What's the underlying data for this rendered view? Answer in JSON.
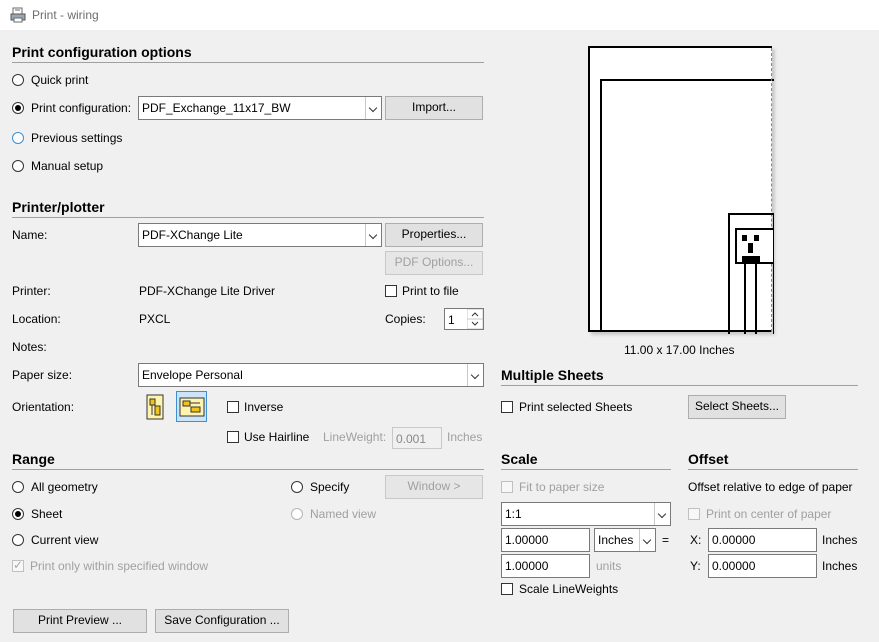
{
  "window": {
    "title": "Print - wiring"
  },
  "config": {
    "heading": "Print configuration options",
    "quick_print": "Quick print",
    "print_configuration": "Print configuration:",
    "config_value": "PDF_Exchange_11x17_BW",
    "import_button": "Import...",
    "previous_settings": "Previous settings",
    "manual_setup": "Manual setup"
  },
  "printer": {
    "heading": "Printer/plotter",
    "name_label": "Name:",
    "name_value": "PDF-XChange Lite",
    "properties_button": "Properties...",
    "pdf_options_button": "PDF Options...",
    "printer_label": "Printer:",
    "printer_value": "PDF-XChange Lite Driver",
    "print_to_file": "Print to file",
    "location_label": "Location:",
    "location_value": "PXCL",
    "copies_label": "Copies:",
    "copies_value": "1",
    "notes_label": "Notes:",
    "paper_size_label": "Paper size:",
    "paper_size_value": "Envelope Personal",
    "orientation_label": "Orientation:",
    "inverse": "Inverse",
    "use_hairline": "Use Hairline",
    "lineweight_label": "LineWeight:",
    "lineweight_value": "0.001",
    "lineweight_unit": "Inches"
  },
  "preview": {
    "caption": "11.00 x 17.00 Inches"
  },
  "multiple_sheets": {
    "heading": "Multiple Sheets",
    "print_selected": "Print selected Sheets",
    "select_button": "Select Sheets..."
  },
  "range": {
    "heading": "Range",
    "all_geometry": "All geometry",
    "specify": "Specify",
    "window_button": "Window >",
    "sheet": "Sheet",
    "named_view": "Named view",
    "current_view": "Current view",
    "print_only": "Print only within specified window"
  },
  "scale": {
    "heading": "Scale",
    "fit_to_paper": "Fit to paper size",
    "ratio_value": "1:1",
    "value1": "1.00000",
    "unit_value": "Inches",
    "equals": "=",
    "value2": "1.00000",
    "units_label": "units",
    "scale_lineweights": "Scale LineWeights"
  },
  "offset": {
    "heading": "Offset",
    "relative": "Offset relative to edge of paper",
    "center": "Print on center of paper",
    "x_label": "X:",
    "x_value": "0.00000",
    "x_unit": "Inches",
    "y_label": "Y:",
    "y_value": "0.00000",
    "y_unit": "Inches"
  },
  "footer": {
    "print_preview": "Print Preview ...",
    "save_configuration": "Save Configuration ..."
  }
}
